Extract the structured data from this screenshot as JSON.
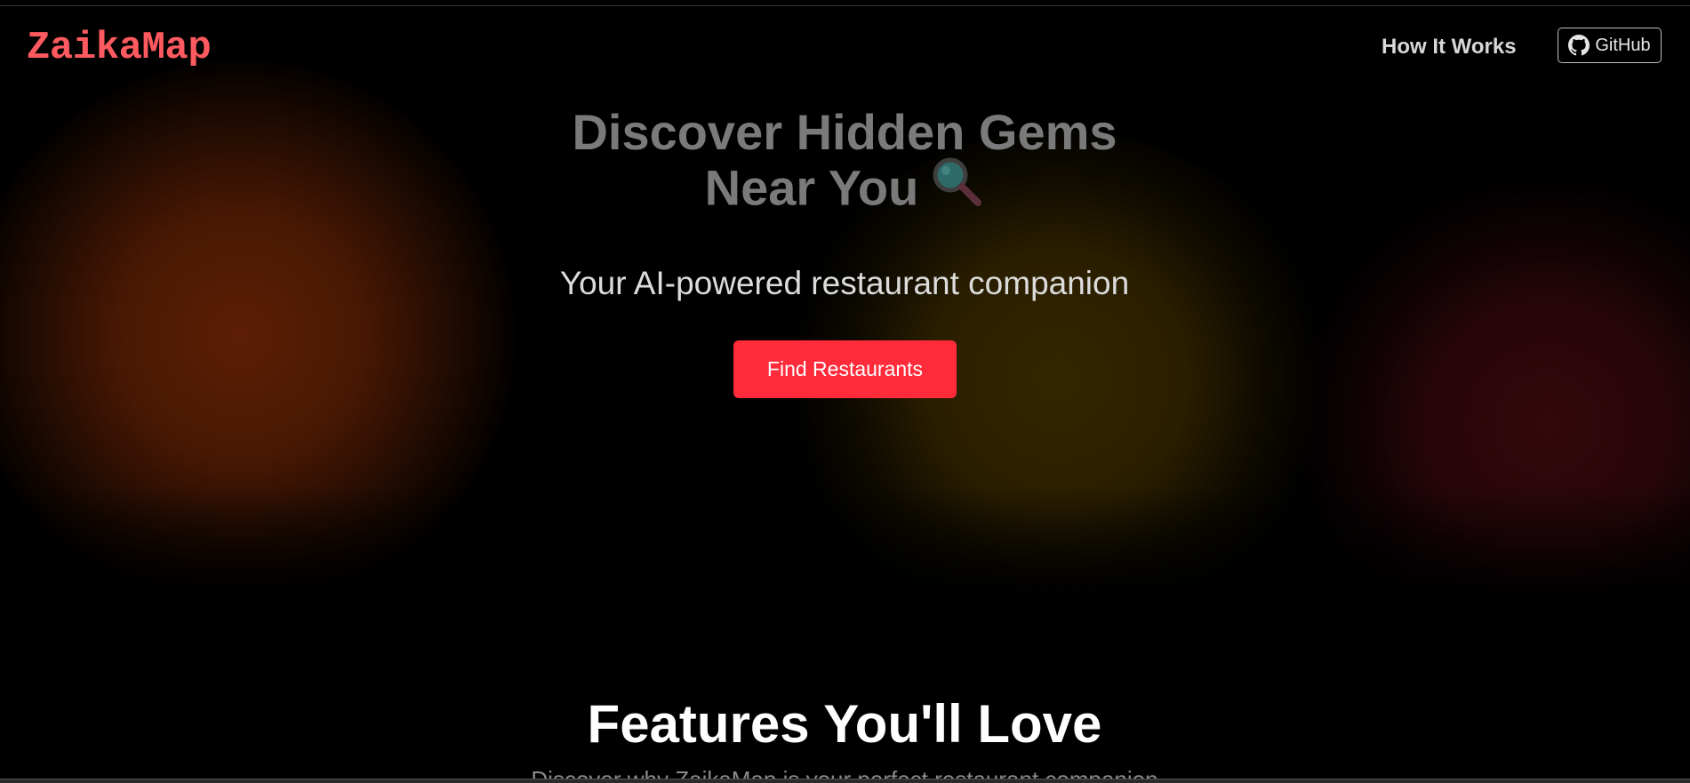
{
  "brand": {
    "logo_text": "ZaikaMap",
    "logo_color": "#ff5a5f"
  },
  "nav": {
    "how_it_works_label": "How It Works",
    "github_label": "GitHub",
    "github_icon": "github-icon"
  },
  "hero": {
    "headline_line1": "Discover Hidden Gems",
    "headline_line2": "Near You",
    "headline_icon": "magnifying-glass-icon",
    "subtitle": "Your AI-powered restaurant companion",
    "cta_label": "Find Restaurants",
    "cta_color": "#ff2a3a",
    "background_glows": [
      "#5c1e04",
      "#342600",
      "#32080c"
    ]
  },
  "features": {
    "title": "Features You'll Love",
    "subtitle": "Discover why ZaikaMap is your perfect restaurant companion"
  }
}
